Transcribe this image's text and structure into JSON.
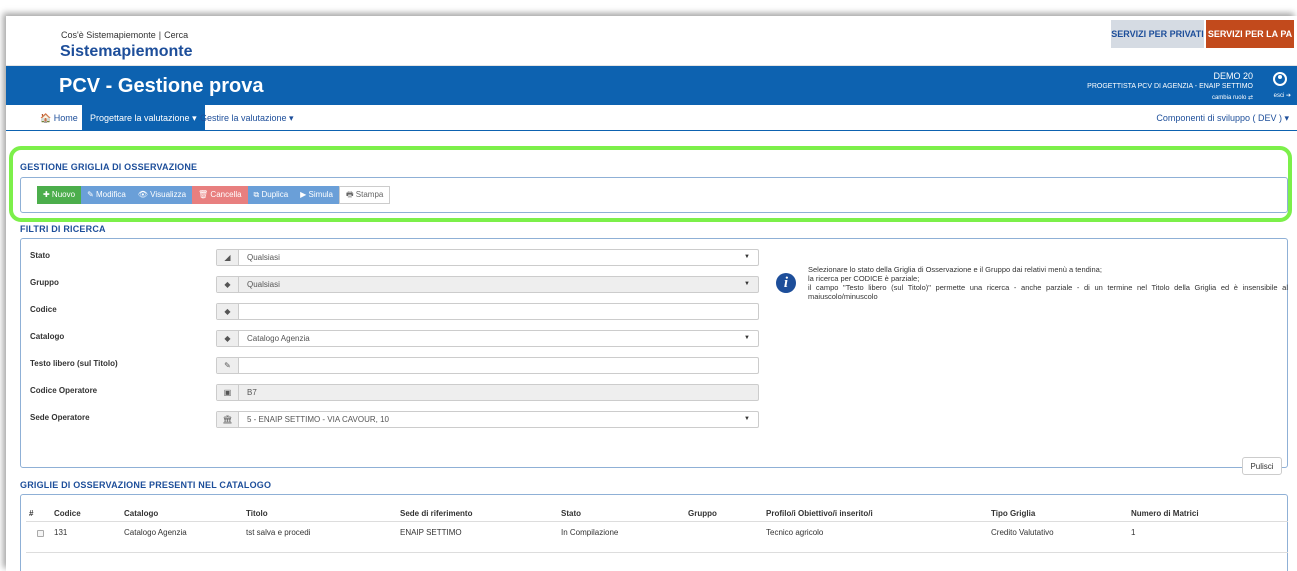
{
  "sitebar": {
    "link_about": "Cos'è Sistemapiemonte",
    "link_search": "Cerca",
    "separator": "|",
    "brand": "Sistemapiemonte",
    "btn_private": "SERVIZI PER PRIVATI",
    "btn_pa": "SERVIZI PER LA PA"
  },
  "header": {
    "title": "PCV - Gestione prova",
    "user_name": "DEMO 20",
    "user_role": "PROGETTISTA PCV DI AGENZIA - ENAIP SETTIMO",
    "change_role": "cambia ruolo ⇄",
    "logout": "esci ➔"
  },
  "nav": {
    "home": "🏠 Home",
    "design": "Progettare la valutazione ▾",
    "manage": "Gestire la valutazione ▾",
    "dev": "Componenti di sviluppo ( DEV ) ▾"
  },
  "grid_section": {
    "title": "GESTIONE GRIGLIA DI OSSERVAZIONE",
    "buttons": {
      "new": "✚ Nuovo",
      "edit": "✎ Modifica",
      "view": "👁 Visualizza",
      "delete": "🗑 Cancella",
      "duplicate": "⧉ Duplica",
      "simulate": "▶ Simula",
      "print": "🖶 Stampa"
    }
  },
  "filters": {
    "title": "FILTRI DI RICERCA",
    "fields": [
      {
        "label": "Stato",
        "value": "Qualsiasi",
        "icon": "◢"
      },
      {
        "label": "Gruppo",
        "value": "Qualsiasi",
        "icon": "◆"
      },
      {
        "label": "Codice",
        "value": "",
        "icon": "◆"
      },
      {
        "label": "Catalogo",
        "value": "Catalogo Agenzia",
        "icon": "◆"
      },
      {
        "label": "Testo libero (sul Titolo)",
        "value": "",
        "icon": "✎"
      },
      {
        "label": "Codice Operatore",
        "value": "B7",
        "icon": "▣"
      },
      {
        "label": "Sede Operatore",
        "value": "5 - ENAIP SETTIMO - VIA CAVOUR, 10",
        "icon": "🏛"
      }
    ],
    "info_line1": "Selezionare lo stato della Griglia di Osservazione e il Gruppo dai relativi menù a tendina;",
    "info_line2": "la ricerca per CODICE è parziale;",
    "info_line3": "il campo \"Testo libero (sul Titolo)\" permette una ricerca - anche parziale - di un termine nel Titolo della Griglia ed è insensibile al maiuscolo/minuscolo",
    "clear_button": "Pulisci"
  },
  "table": {
    "title": "GRIGLIE DI OSSERVAZIONE PRESENTI NEL CATALOGO",
    "headers": [
      "#",
      "Codice",
      "Catalogo",
      "Titolo",
      "Sede di riferimento",
      "Stato",
      "Gruppo",
      "Profilo/i Obiettivo/i inserito/i",
      "Tipo Griglia",
      "Numero di Matrici"
    ],
    "rows": [
      [
        "",
        "131",
        "Catalogo Agenzia",
        "tst salva e procedi",
        "ENAIP SETTIMO",
        "In Compilazione",
        "",
        "Tecnico agricolo",
        "Credito Valutativo",
        "1"
      ]
    ]
  }
}
